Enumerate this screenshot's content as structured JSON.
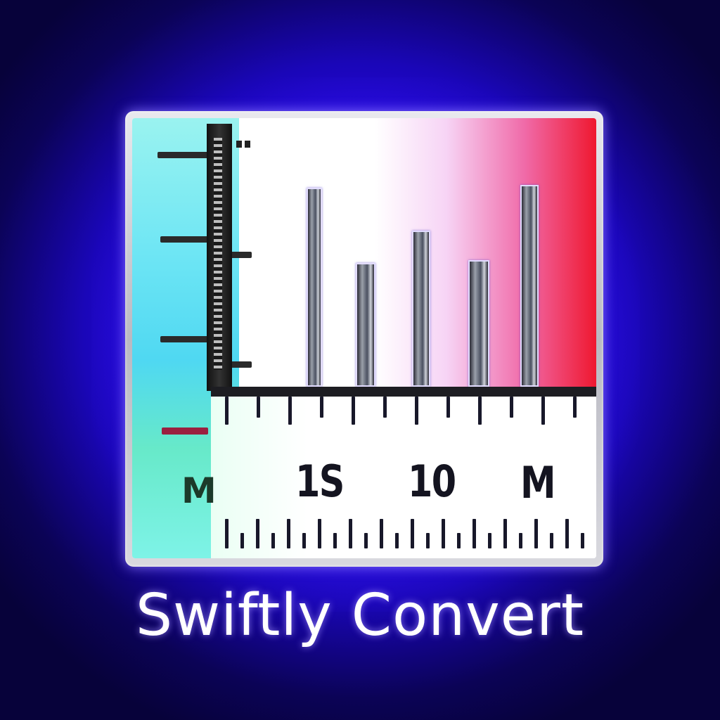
{
  "app": {
    "name": "Swiftly Convert"
  },
  "icon": {
    "name": "ruler-chart-icon",
    "ruler_labels": [
      "1S",
      "10",
      "M"
    ],
    "ruler_left_label": "M",
    "bar_levels": [
      0.74,
      0.46,
      0.58,
      0.47,
      0.75
    ]
  },
  "colors": {
    "background": "#2a08f0",
    "left_band": "#5fdcf2",
    "gradient_right": "#ef1830",
    "title_text": "#ffffff"
  }
}
